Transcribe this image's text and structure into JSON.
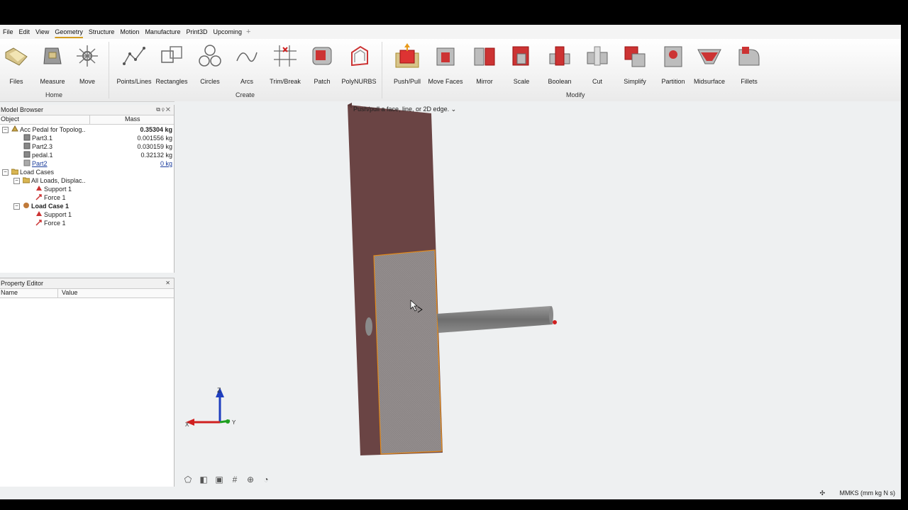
{
  "menu": [
    "File",
    "Edit",
    "View",
    "Geometry",
    "Structure",
    "Motion",
    "Manufacture",
    "Print3D",
    "Upcoming"
  ],
  "menu_active": "Geometry",
  "ribbon": {
    "home": [
      {
        "name": "files-button",
        "icon": "folder-icon",
        "label": "Files"
      },
      {
        "name": "measure-button",
        "icon": "measure-icon",
        "label": "Measure"
      },
      {
        "name": "move-button",
        "icon": "move-icon",
        "label": "Move"
      }
    ],
    "create": [
      {
        "name": "points-lines-button",
        "icon": "points-lines-icon",
        "label": "Points/Lines"
      },
      {
        "name": "rectangles-button",
        "icon": "rectangles-icon",
        "label": "Rectangles"
      },
      {
        "name": "circles-button",
        "icon": "circles-icon",
        "label": "Circles"
      },
      {
        "name": "arcs-button",
        "icon": "arcs-icon",
        "label": "Arcs"
      },
      {
        "name": "trim-break-button",
        "icon": "trim-break-icon",
        "label": "Trim/Break"
      },
      {
        "name": "patch-button",
        "icon": "patch-icon",
        "label": "Patch"
      },
      {
        "name": "polynurbs-button",
        "icon": "polynurbs-icon",
        "label": "PolyNURBS"
      }
    ],
    "modify": [
      {
        "name": "push-pull-button",
        "icon": "push-pull-icon",
        "label": "Push/Pull"
      },
      {
        "name": "move-faces-button",
        "icon": "move-faces-icon",
        "label": "Move Faces"
      },
      {
        "name": "mirror-button",
        "icon": "mirror-icon",
        "label": "Mirror"
      },
      {
        "name": "scale-button",
        "icon": "scale-icon",
        "label": "Scale"
      },
      {
        "name": "boolean-button",
        "icon": "boolean-icon",
        "label": "Boolean"
      },
      {
        "name": "cut-button",
        "icon": "cut-icon",
        "label": "Cut"
      },
      {
        "name": "simplify-button",
        "icon": "simplify-icon",
        "label": "Simplify"
      },
      {
        "name": "partition-button",
        "icon": "partition-icon",
        "label": "Partition"
      },
      {
        "name": "midsurface-button",
        "icon": "midsurface-icon",
        "label": "Midsurface"
      },
      {
        "name": "fillets-button",
        "icon": "fillets-icon",
        "label": "Fillets"
      }
    ],
    "groups": {
      "home": "Home",
      "create": "Create",
      "modify": "Modify"
    }
  },
  "model_browser": {
    "title": "Model Browser",
    "col_object": "Object",
    "col_mass": "Mass",
    "rows": [
      {
        "label": "Acc Pedal for Topolog..",
        "mass": "0.35304 kg",
        "bold_mass": true
      },
      {
        "label": "Part3.1",
        "mass": "0.001556 kg"
      },
      {
        "label": "Part2.3",
        "mass": "0.030159 kg"
      },
      {
        "label": "pedal.1",
        "mass": "0.32132 kg"
      },
      {
        "label": "Part2",
        "mass": "0 kg",
        "link": true
      },
      {
        "label": "Load Cases"
      },
      {
        "label": "All Loads, Displac.."
      },
      {
        "label": "Support 1"
      },
      {
        "label": "Force 1"
      },
      {
        "label": "Load Case 1",
        "bold": true
      },
      {
        "label": "Support 1"
      },
      {
        "label": "Force 1"
      }
    ]
  },
  "property_editor": {
    "title": "Property Editor",
    "col_name": "Name",
    "col_value": "Value"
  },
  "viewport": {
    "hint": "Push/pull a face, line, or 2D edge.",
    "axes": {
      "z": "Z",
      "x": "X",
      "y": "Y"
    }
  },
  "status": {
    "units": "MMKS (mm kg N s)"
  },
  "colors": {
    "accent": "#d39d1d",
    "part_body": "#6a4242",
    "part_face": "#8a8686",
    "rod": "#7d7d7d",
    "highlight_edge": "#e38a1a"
  }
}
